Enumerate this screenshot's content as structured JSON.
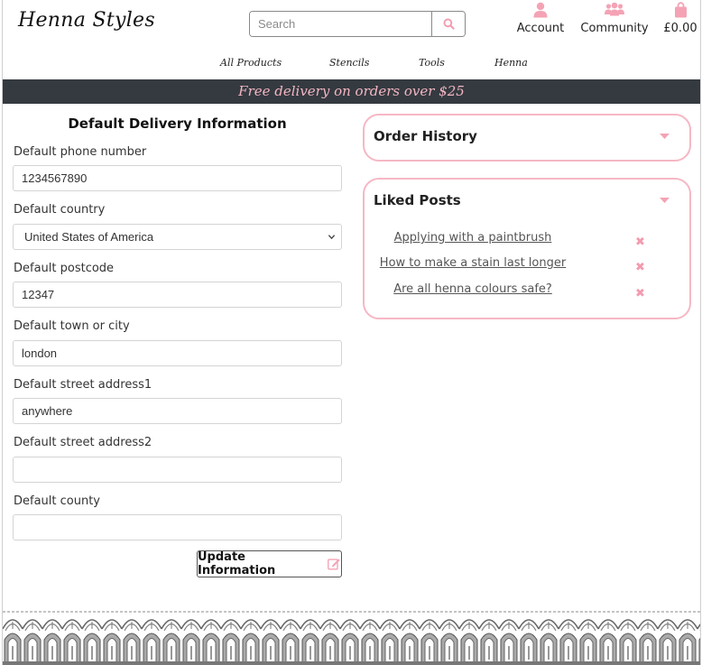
{
  "header": {
    "logo": "Henna Styles",
    "search_placeholder": "Search",
    "account_label": "Account",
    "community_label": "Community",
    "bag_total": "£0.00"
  },
  "nav": {
    "items": [
      "All Products",
      "Stencils",
      "Tools",
      "Henna"
    ]
  },
  "banner": "Free delivery on orders over $25",
  "form": {
    "title": "Default Delivery Information",
    "phone_label": "Default phone number",
    "phone_value": "1234567890",
    "country_label": "Default country",
    "country_value": "United States of America",
    "postcode_label": "Default postcode",
    "postcode_value": "12347",
    "town_label": "Default town or city",
    "town_value": "london",
    "street1_label": "Default street address1",
    "street1_value": "anywhere",
    "street2_label": "Default street address2",
    "street2_value": "",
    "county_label": "Default county",
    "county_value": "",
    "submit_label": "Update Information"
  },
  "order_history": {
    "title": "Order History"
  },
  "liked_posts": {
    "title": "Liked Posts",
    "items": [
      "Applying with a paintbrush",
      "How to make a stain last longer",
      "Are all henna colours safe?"
    ]
  },
  "colors": {
    "accent_pink": "#f6b7c4",
    "banner_bg": "#343a40",
    "banner_text": "#f4b6c2"
  },
  "icons": [
    "search-icon",
    "account-icon",
    "community-icon",
    "shopping-bag-icon",
    "edit-icon",
    "caret-down-icon",
    "remove-icon",
    "chevron-down-icon"
  ]
}
